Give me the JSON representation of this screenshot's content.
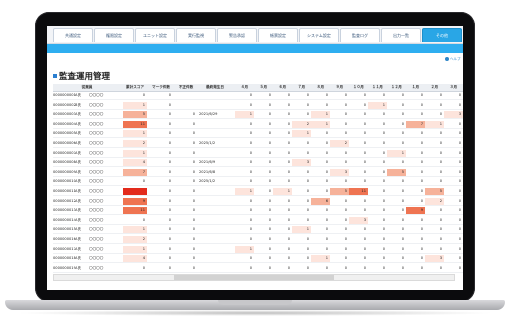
{
  "tabs": [
    {
      "label": "共通設定",
      "active": false
    },
    {
      "label": "権限設定",
      "active": false
    },
    {
      "label": "ユニット設定",
      "active": false
    },
    {
      "label": "実行監視",
      "active": false
    },
    {
      "label": "警告承認",
      "active": false
    },
    {
      "label": "帳票設定",
      "active": false
    },
    {
      "label": "システム設定",
      "active": false
    },
    {
      "label": "監査ログ",
      "active": false
    },
    {
      "label": "出力一覧",
      "active": false
    },
    {
      "label": "その他",
      "active": true
    }
  ],
  "help_label": "ヘルプ",
  "page_title": "監査運用管理",
  "columns": [
    "従業員",
    "",
    "",
    "累計スコア",
    "マーク件数",
    "不正件数",
    "最終発生日",
    "４月",
    "５月",
    "６月",
    "７月",
    "８月",
    "９月",
    "１０月",
    "１１月",
    "１２月",
    "１月",
    "２月",
    "３月"
  ],
  "rows": [
    {
      "id": "0000000001",
      "name": "A氏",
      "org": "〇〇〇〇",
      "score": "0",
      "mark": "0",
      "ng": "",
      "date": "",
      "m": [
        "0",
        "0",
        "0",
        "0",
        "0",
        "0",
        "0",
        "0",
        "0",
        "0",
        "0",
        "0"
      ]
    },
    {
      "id": "0000000002",
      "name": "B氏",
      "org": "〇〇〇〇",
      "score": "1",
      "mark": "0",
      "ng": "",
      "date": "",
      "m": [
        "0",
        "0",
        "0",
        "0",
        "0",
        "0",
        "0",
        "1",
        "0",
        "0",
        "0",
        "0"
      ]
    },
    {
      "id": "0000000003",
      "name": "A氏",
      "org": "〇〇〇〇",
      "score": "5",
      "mark": "0",
      "ng": "0",
      "date": "2021/6/29",
      "m": [
        "1",
        "0",
        "0",
        "0",
        "1",
        "0",
        "0",
        "0",
        "0",
        "0",
        "0",
        "3"
      ]
    },
    {
      "id": "0000000004",
      "name": "A氏",
      "org": "〇〇〇〇",
      "score": "11",
      "mark": "0",
      "ng": "0",
      "date": "",
      "m": [
        "0",
        "0",
        "0",
        "2",
        "1",
        "0",
        "0",
        "0",
        "0",
        "7",
        "1",
        "0"
      ]
    },
    {
      "id": "0000000005",
      "name": "A氏",
      "org": "〇〇〇〇",
      "score": "1",
      "mark": "0",
      "ng": "0",
      "date": "",
      "m": [
        "0",
        "0",
        "0",
        "1",
        "0",
        "0",
        "0",
        "0",
        "0",
        "0",
        "0",
        "0"
      ]
    },
    {
      "id": "0000000006",
      "name": "A氏",
      "org": "〇〇〇〇",
      "score": "2",
      "mark": "0",
      "ng": "0",
      "date": "2025/1/2",
      "m": [
        "0",
        "0",
        "0",
        "0",
        "0",
        "2",
        "0",
        "0",
        "0",
        "0",
        "0",
        "0"
      ]
    },
    {
      "id": "0000000007",
      "name": "A氏",
      "org": "〇〇〇〇",
      "score": "1",
      "mark": "0",
      "ng": "0",
      "date": "",
      "m": [
        "0",
        "0",
        "0",
        "0",
        "0",
        "0",
        "0",
        "0",
        "1",
        "0",
        "0",
        "0"
      ]
    },
    {
      "id": "0000000008",
      "name": "A氏",
      "org": "〇〇〇〇",
      "score": "4",
      "mark": "0",
      "ng": "0",
      "date": "2021/6/9",
      "m": [
        "0",
        "0",
        "0",
        "3",
        "0",
        "0",
        "0",
        "0",
        "0",
        "0",
        "0",
        "0"
      ]
    },
    {
      "id": "0000000009",
      "name": "A氏",
      "org": "〇〇〇〇",
      "score": "7",
      "mark": "0",
      "ng": "0",
      "date": "2021/6/8",
      "m": [
        "0",
        "0",
        "0",
        "0",
        "0",
        "3",
        "0",
        "0",
        "5",
        "0",
        "0",
        "0"
      ]
    },
    {
      "id": "0000000010",
      "name": "A氏",
      "org": "〇〇〇〇",
      "score": "0",
      "mark": "0",
      "ng": "0",
      "date": "2025/1/2",
      "m": [
        "0",
        "0",
        "0",
        "0",
        "0",
        "0",
        "0",
        "0",
        "0",
        "0",
        "0",
        "0"
      ]
    },
    {
      "id": "0000000011",
      "name": "A氏",
      "org": "〇〇〇〇",
      "score": "",
      "mark": "0",
      "ng": "0",
      "date": "",
      "m": [
        "1",
        "0",
        "1",
        "0",
        "0",
        "5",
        "11",
        "0",
        "0",
        "0",
        "5",
        "0"
      ]
    },
    {
      "id": "0000000012",
      "name": "A氏",
      "org": "〇〇〇〇",
      "score": "9",
      "mark": "0",
      "ng": "0",
      "date": "",
      "m": [
        "0",
        "0",
        "0",
        "0",
        "6",
        "0",
        "0",
        "0",
        "0",
        "0",
        "2",
        "0"
      ]
    },
    {
      "id": "0000000013",
      "name": "A氏",
      "org": "〇〇〇〇",
      "score": "11",
      "mark": "0",
      "ng": "0",
      "date": "",
      "m": [
        "0",
        "0",
        "0",
        "0",
        "0",
        "0",
        "0",
        "0",
        "0",
        "9",
        "0",
        "0"
      ]
    },
    {
      "id": "0000000014",
      "name": "A氏",
      "org": "〇〇〇〇",
      "score": "0",
      "mark": "0",
      "ng": "0",
      "date": "",
      "m": [
        "0",
        "0",
        "0",
        "0",
        "0",
        "0",
        "3",
        "0",
        "0",
        "0",
        "0",
        "0"
      ]
    },
    {
      "id": "0000000015",
      "name": "A氏",
      "org": "〇〇〇〇",
      "score": "1",
      "mark": "0",
      "ng": "0",
      "date": "",
      "m": [
        "0",
        "0",
        "0",
        "1",
        "0",
        "0",
        "0",
        "0",
        "0",
        "0",
        "0",
        "0"
      ]
    },
    {
      "id": "0000000016",
      "name": "A氏",
      "org": "〇〇〇〇",
      "score": "2",
      "mark": "0",
      "ng": "0",
      "date": "",
      "m": [
        "0",
        "0",
        "0",
        "0",
        "0",
        "0",
        "0",
        "0",
        "0",
        "0",
        "0",
        "0"
      ]
    },
    {
      "id": "0000000017",
      "name": "A氏",
      "org": "〇〇〇〇",
      "score": "1",
      "mark": "0",
      "ng": "0",
      "date": "",
      "m": [
        "1",
        "0",
        "0",
        "0",
        "0",
        "0",
        "0",
        "0",
        "0",
        "0",
        "0",
        "0"
      ]
    },
    {
      "id": "0000000018",
      "name": "A氏",
      "org": "〇〇〇〇",
      "score": "4",
      "mark": "0",
      "ng": "0",
      "date": "",
      "m": [
        "0",
        "0",
        "0",
        "0",
        "1",
        "0",
        "0",
        "0",
        "0",
        "0",
        "3",
        "0"
      ]
    },
    {
      "id": "0000000019",
      "name": "A氏",
      "org": "〇〇〇〇",
      "score": "0",
      "mark": "0",
      "ng": "0",
      "date": "",
      "m": [
        "0",
        "0",
        "0",
        "0",
        "0",
        "0",
        "0",
        "0",
        "0",
        "0",
        "0",
        "0"
      ]
    }
  ],
  "colors": {
    "accent": "#2eaef0",
    "heat_low": "#fde4dc",
    "heat_mid": "#f6b29a",
    "heat_high": "#ef7452",
    "heat_max": "#e32b1c"
  }
}
